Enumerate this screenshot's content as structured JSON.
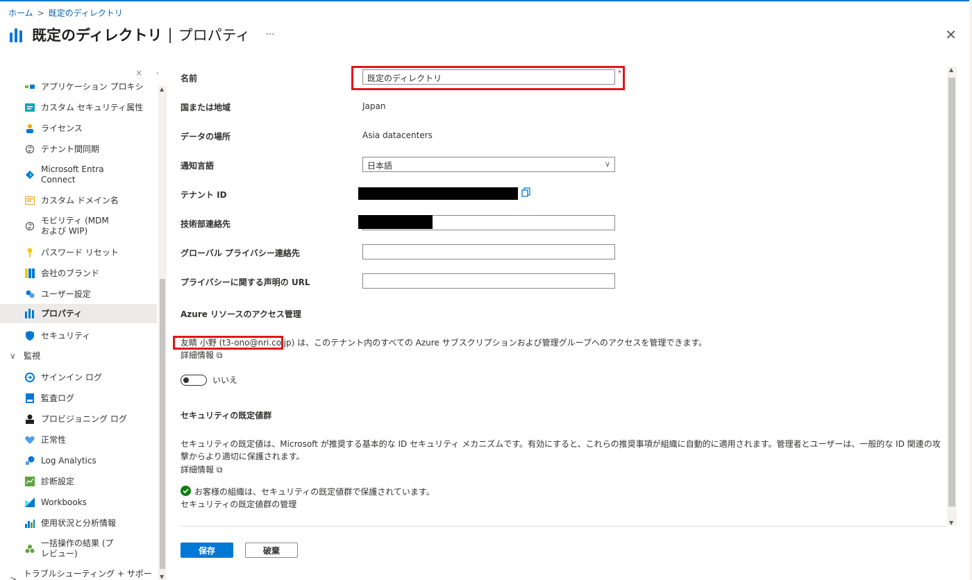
{
  "breadcrumb": {
    "home": "ホーム",
    "separator": ">",
    "current": "既定のディレクトリ"
  },
  "title": {
    "main": "既定のディレクトリ",
    "separator": "|",
    "sub": "プロパティ",
    "more": "···"
  },
  "close_glyph": "✕",
  "sidebar": {
    "collapse_glyph": "«",
    "clear_glyph": "×",
    "items": [
      {
        "label": "アプリケーション プロキシ",
        "icon": "app-proxy-icon"
      },
      {
        "label": "カスタム セキュリティ属性",
        "icon": "custom-attributes-icon"
      },
      {
        "label": "ライセンス",
        "icon": "license-icon"
      },
      {
        "label": "テナント間同期",
        "icon": "sync-icon"
      },
      {
        "label": "Microsoft Entra Connect",
        "icon": "entra-connect-icon"
      },
      {
        "label": "カスタム ドメイン名",
        "icon": "domain-icon"
      },
      {
        "label": "モビリティ (MDM および WIP)",
        "icon": "mobility-icon"
      },
      {
        "label": "パスワード リセット",
        "icon": "key-icon"
      },
      {
        "label": "会社のブランド",
        "icon": "branding-icon"
      },
      {
        "label": "ユーザー設定",
        "icon": "user-settings-icon"
      },
      {
        "label": "プロパティ",
        "icon": "properties-icon",
        "active": true
      },
      {
        "label": "セキュリティ",
        "icon": "shield-icon"
      }
    ],
    "group_monitor": {
      "label": "監視",
      "chevron": "∨"
    },
    "monitor_items": [
      {
        "label": "サインイン ログ",
        "icon": "signin-log-icon"
      },
      {
        "label": "監査ログ",
        "icon": "audit-log-icon"
      },
      {
        "label": "プロビジョニング ログ",
        "icon": "provisioning-icon"
      },
      {
        "label": "正常性",
        "icon": "health-icon"
      },
      {
        "label": "Log Analytics",
        "icon": "log-analytics-icon"
      },
      {
        "label": "診断設定",
        "icon": "diagnostics-icon"
      },
      {
        "label": "Workbooks",
        "icon": "workbooks-icon"
      },
      {
        "label": "使用状況と分析情報",
        "icon": "usage-icon"
      },
      {
        "label": "一括操作の結果 (プレビュー)",
        "icon": "bulk-icon"
      }
    ],
    "group_troubleshoot": {
      "label": "トラブルシューティング + サポート",
      "chevron": ">"
    }
  },
  "form": {
    "name_label": "名前",
    "name_value": "既定のディレクトリ",
    "required_mark": "*",
    "country_label": "国または地域",
    "country_value": "Japan",
    "data_location_label": "データの場所",
    "data_location_value": "Asia datacenters",
    "language_label": "通知言語",
    "language_value": "日本語",
    "language_caret": "∨",
    "tenant_id_label": "テナント ID",
    "tech_contact_label": "技術部連絡先",
    "privacy_contact_label": "グローバル プライバシー連絡先",
    "privacy_url_label": "プライバシーに関する声明の URL"
  },
  "azure_access": {
    "title": "Azure リソースのアクセス管理",
    "text": "友睛 小野 (t3-ono@nri.co.jp) は、このテナント内のすべての Azure サブスクリプションおよび管理グループへのアクセスを管理できます。",
    "learn_more": "詳細情報",
    "toggle_label": "いいえ"
  },
  "security_defaults": {
    "title": "セキュリティの既定値群",
    "text": "セキュリティの既定値は、Microsoft が推奨する基本的な ID セキュリティ メカニズムです。有効にすると、これらの推奨事項が組織に自動的に適用されます。管理者とユーザーは、一般的な ID 関連の攻撃からより適切に保護されます。",
    "learn_more": "詳細情報",
    "status": "お客様の組織は、セキュリティの既定値群で保護されています。",
    "manage_link": "セキュリティの既定値群の管理"
  },
  "buttons": {
    "save": "保存",
    "discard": "破棄"
  },
  "colors": {
    "accent": "#0078d4",
    "highlight": "#e3141b",
    "success": "#107c10"
  }
}
